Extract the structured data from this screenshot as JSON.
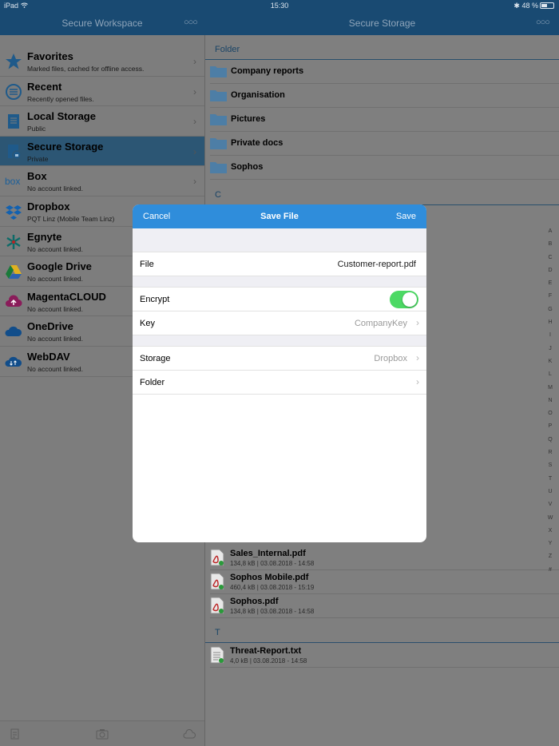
{
  "status": {
    "device": "iPad",
    "time": "15:30",
    "battery": "48 %",
    "battery_level": 0.48
  },
  "left_nav": {
    "title": "Secure Workspace"
  },
  "right_nav": {
    "title": "Secure Storage"
  },
  "menu": [
    {
      "title": "Favorites",
      "subtitle": "Marked files, cached for offline access.",
      "icon": "star-icon",
      "color": "#1f5a8a"
    },
    {
      "title": "Recent",
      "subtitle": "Recently opened files.",
      "icon": "recent-icon",
      "color": "#1f5a8a"
    },
    {
      "title": "Local Storage",
      "subtitle": "Public",
      "icon": "local-storage-icon",
      "color": "#1f5a8a"
    },
    {
      "title": "Secure Storage",
      "subtitle": "Private",
      "icon": "secure-storage-icon",
      "color": "#1f5a8a"
    },
    {
      "title": "Box",
      "subtitle": "No account linked.",
      "icon": "box-logo-icon",
      "color": "#1b5f9a"
    },
    {
      "title": "Dropbox",
      "subtitle": "PQT Linz (Mobile Team Linz)",
      "icon": "dropbox-icon",
      "color": "#1261b0"
    },
    {
      "title": "Egnyte",
      "subtitle": "No account linked.",
      "icon": "egnyte-icon",
      "color": "#0d6b68"
    },
    {
      "title": "Google Drive",
      "subtitle": "No account linked.",
      "icon": "google-drive-icon",
      "color": "#1a7a3a"
    },
    {
      "title": "MagentaCLOUD",
      "subtitle": "No account linked.",
      "icon": "magenta-cloud-icon",
      "color": "#8a1c5a"
    },
    {
      "title": "OneDrive",
      "subtitle": "No account linked.",
      "icon": "onedrive-icon",
      "color": "#114d8a"
    },
    {
      "title": "WebDAV",
      "subtitle": "No account linked.",
      "icon": "webdav-icon",
      "color": "#114d8a"
    }
  ],
  "sections": {
    "folder": "Folder",
    "c": "C",
    "t": "T"
  },
  "folders": [
    "Company reports",
    "Organisation",
    "Pictures",
    "Private docs",
    "Sophos"
  ],
  "files": [
    {
      "name": "Sales_Internal.pdf",
      "meta": "134,8 kB | 03.08.2018 - 14:58",
      "icon": "pdf-icon"
    },
    {
      "name": "Sophos Mobile.pdf",
      "meta": "460,4 kB | 03.08.2018 - 15:19",
      "icon": "pdf-icon"
    },
    {
      "name": "Sophos.pdf",
      "meta": "134,8 kB | 03.08.2018 - 14:58",
      "icon": "pdf-icon"
    }
  ],
  "t_files": [
    {
      "name": "Threat-Report.txt",
      "meta": "4,0 kB | 03.08.2018 - 14:58",
      "icon": "txt-icon"
    }
  ],
  "index_letters": [
    "A",
    "B",
    "C",
    "D",
    "E",
    "F",
    "G",
    "H",
    "I",
    "J",
    "K",
    "L",
    "M",
    "N",
    "O",
    "P",
    "Q",
    "R",
    "S",
    "T",
    "U",
    "V",
    "W",
    "X",
    "Y",
    "Z",
    "#"
  ],
  "modal": {
    "cancel": "Cancel",
    "title": "Save File",
    "save": "Save",
    "file_label": "File",
    "file_value": "Customer-report.pdf",
    "encrypt_label": "Encrypt",
    "encrypt_on": true,
    "key_label": "Key",
    "key_value": "CompanyKey",
    "storage_label": "Storage",
    "storage_value": "Dropbox",
    "folder_label": "Folder"
  },
  "colors": {
    "nav": "#194a72",
    "accent": "#2f8ddb",
    "toggle_on": "#4cd964"
  }
}
